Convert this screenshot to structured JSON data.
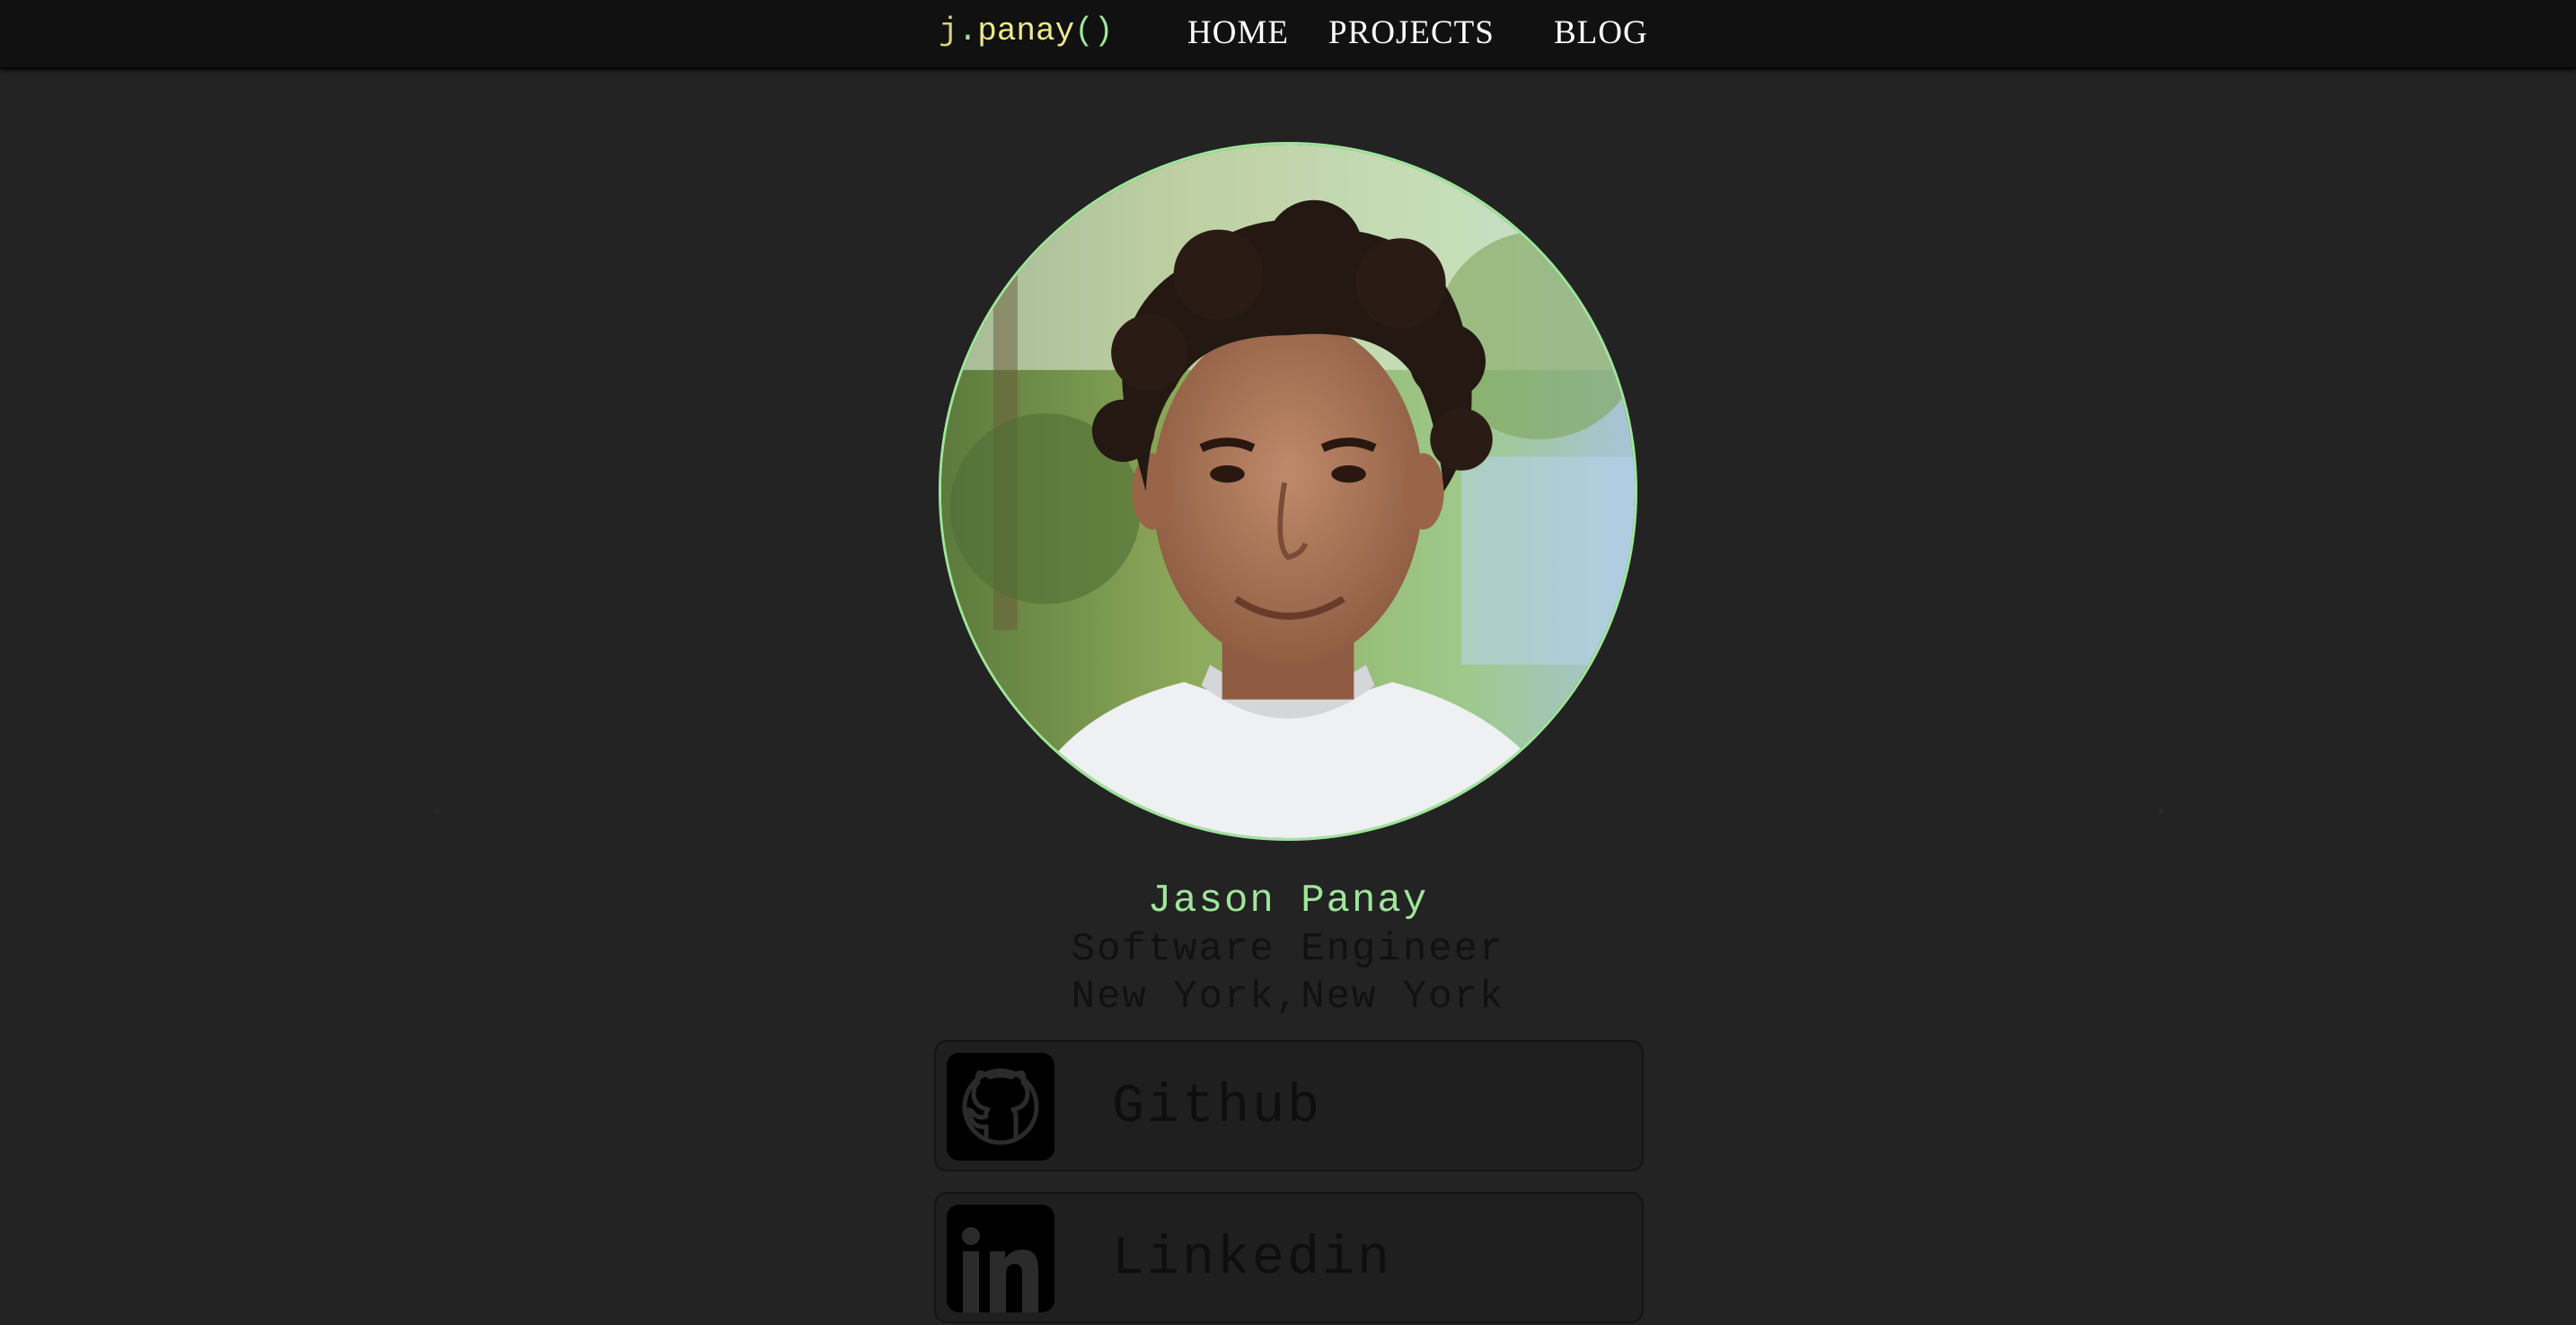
{
  "nav": {
    "brand": {
      "j": "j",
      "dot": ".",
      "name": "panay",
      "parens": "()"
    },
    "links": [
      {
        "label": "HOME"
      },
      {
        "label": "PROJECTS"
      },
      {
        "label": "BLOG"
      }
    ]
  },
  "profile": {
    "avatar_icon": "portrait-photo",
    "name": "Jason Panay",
    "title": "Software Engineer",
    "location": "New York,New York"
  },
  "links": [
    {
      "label": "Github",
      "icon": "github-icon"
    },
    {
      "label": "Linkedin",
      "icon": "linkedin-icon"
    }
  ],
  "colors": {
    "background": "#232323",
    "navbar": "#111111",
    "accent": "#9fe59a",
    "brand": "#ecea8c",
    "dark_text": "#111111"
  }
}
